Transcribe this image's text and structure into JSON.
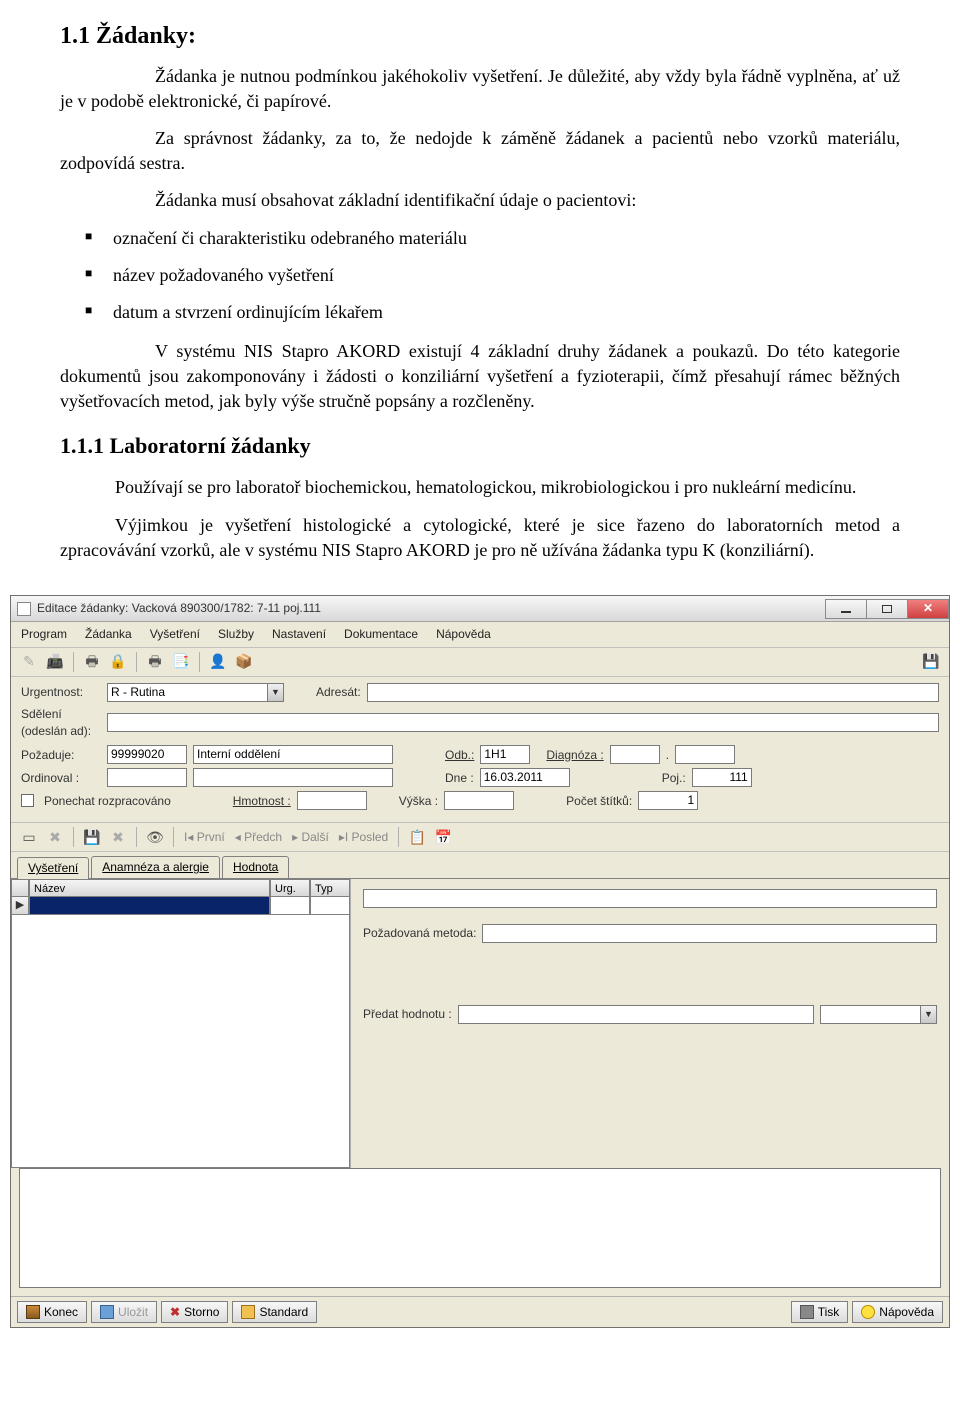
{
  "doc": {
    "h1": "1.1   Žádanky:",
    "p1": "Žádanka je nutnou podmínkou jakéhokoliv vyšetření. Je důležité, aby vždy byla řádně vyplněna, ať už je v podobě elektronické, či papírové.",
    "p2": "Za správnost žádanky, za to, že nedojde k záměně žádanek a pacientů nebo vzorků materiálu, zodpovídá sestra.",
    "p3": "Žádanka musí obsahovat základní identifikační údaje o pacientovi:",
    "bullets": {
      "b1": "označení či charakteristiku odebraného materiálu",
      "b2": "název požadovaného vyšetření",
      "b3": "datum a stvrzení ordinujícím lékařem"
    },
    "p4": "V systému NIS Stapro AKORD existují 4 základní druhy žádanek a poukazů. Do této kategorie dokumentů jsou zakomponovány i žádosti o konziliární vyšetření a fyzioterapii, čímž přesahují rámec běžných vyšetřovacích metod, jak byly výše stručně popsány a rozčleněny.",
    "h2": "1.1.1   Laboratorní žádanky",
    "p5": "Používají se pro laboratoř biochemickou, hematologickou, mikrobiologickou i pro nukleární medicínu.",
    "p6": "Výjimkou je vyšetření histologické a cytologické, které je sice řazeno do laboratorních metod a zpracovávání vzorků, ale v systému NIS Stapro AKORD je pro ně užívána žádanka typu K (konziliární)."
  },
  "app": {
    "title": "Editace žádanky: Vacková  890300/1782: 7-11 poj.111",
    "menu": {
      "m1": "Program",
      "m2": "Žádanka",
      "m3": "Vyšetření",
      "m4": "Služby",
      "m5": "Nastavení",
      "m6": "Dokumentace",
      "m7": "Nápověda"
    },
    "labels": {
      "urgentnost": "Urgentnost:",
      "adresat": "Adresát:",
      "sdeleni": "Sdělení (odeslán ad):",
      "pozaduje": "Požaduje:",
      "ordinoval": "Ordinoval :",
      "odb": "Odb.:",
      "diagnoza": "Diagnóza :",
      "dne": "Dne :",
      "poj": "Poj.:",
      "ponechat": "Ponechat rozpracováno",
      "hmotnost": "Hmotnost :",
      "vyska": "Výška :",
      "pocetStitku": "Počet štítků:",
      "pozadMetoda": "Požadovaná metoda:",
      "predatHodnotu": "Předat hodnotu :"
    },
    "values": {
      "urgentnost": "R - Rutina",
      "pozadujeKod": "99999020",
      "pozadujeOdd": "Interní oddělení",
      "odb": "1H1",
      "dne": "16.03.2011",
      "poj": "111",
      "pocetStitku": "1"
    },
    "navbar": {
      "prvni": "První",
      "predch": "Předch",
      "dalsi": "Další",
      "posled": "Posled"
    },
    "tabs": {
      "t1": "Vyšetření",
      "t2": "Anamnéza a alergie",
      "t3": "Hodnota"
    },
    "grid": {
      "colName": "Název",
      "colUrg": "Urg.",
      "colTyp": "Typ"
    },
    "buttons": {
      "konec": "Konec",
      "ulozit": "Uložit",
      "storno": "Storno",
      "standard": "Standard",
      "tisk": "Tisk",
      "napoveda": "Nápověda"
    }
  }
}
